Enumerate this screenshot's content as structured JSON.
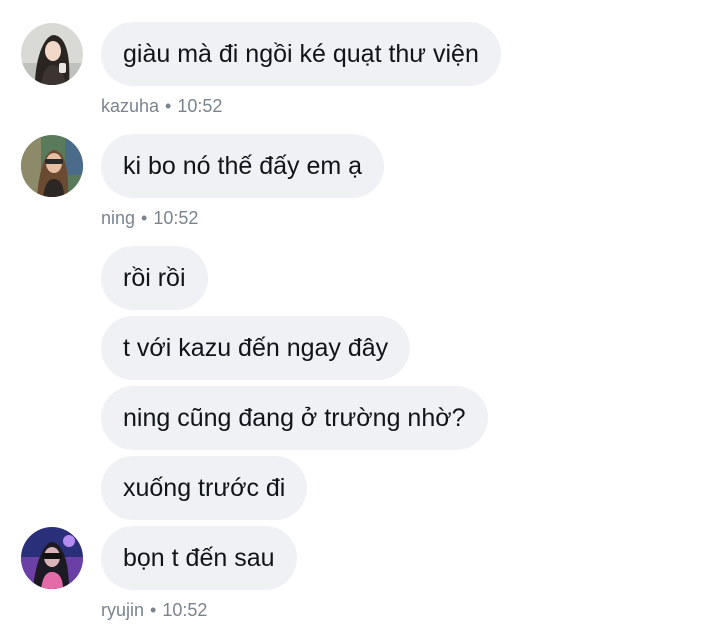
{
  "thread": [
    {
      "sender": "kazuha",
      "messages": [
        "giàu mà đi ngồi ké quạt thư viện"
      ],
      "time": "10:52",
      "avatar": "kazuha-avatar"
    },
    {
      "sender": "ning",
      "messages": [
        "ki bo nó thế đấy em ạ"
      ],
      "time": "10:52",
      "avatar": "ning-avatar"
    },
    {
      "sender": "ryujin",
      "messages": [
        "rồi rồi",
        "t với kazu đến ngay đây",
        "ning cũng đang ở trường nhờ?",
        "xuống trước đi",
        "bọn t đến sau"
      ],
      "time": "10:52",
      "avatar": "ryujin-avatar"
    }
  ],
  "separator": "•",
  "colors": {
    "bubble": "#eff1f4",
    "meta": "#7b848d",
    "text": "#111418"
  }
}
